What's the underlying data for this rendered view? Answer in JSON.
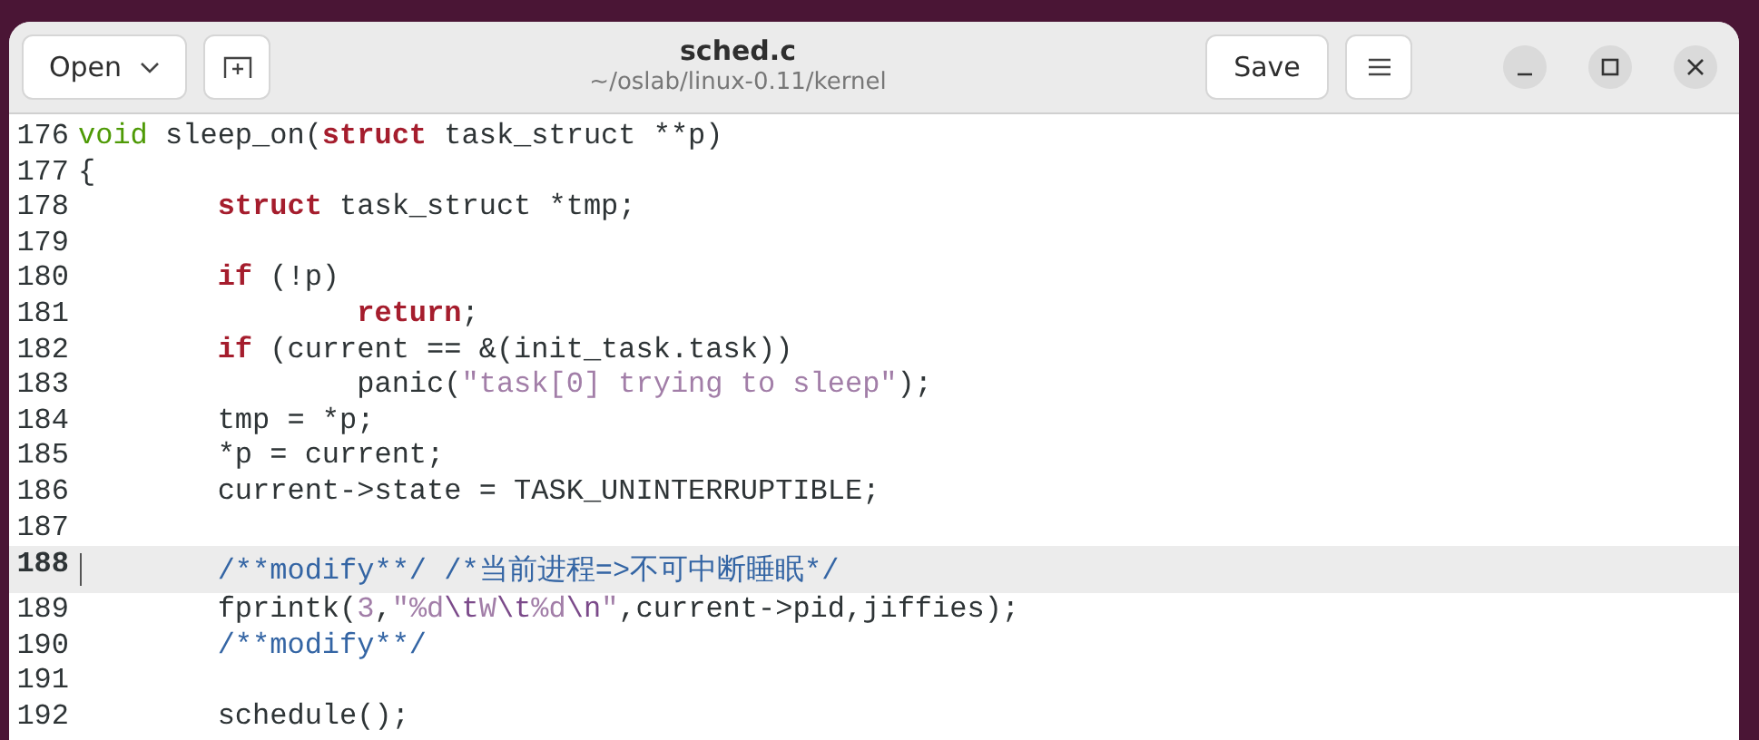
{
  "header": {
    "open_button": "Open",
    "title": "sched.c",
    "subtitle": "~/oslab/linux-0.11/kernel",
    "save_button": "Save"
  },
  "lines": [
    {
      "number": "176",
      "current": false,
      "tokens": [
        {
          "kind": "type",
          "text": "void"
        },
        {
          "kind": "plain",
          "text": " sleep_on("
        },
        {
          "kind": "keyword",
          "text": "struct"
        },
        {
          "kind": "plain",
          "text": " task_struct **p)"
        }
      ]
    },
    {
      "number": "177",
      "current": false,
      "tokens": [
        {
          "kind": "plain",
          "text": "{"
        }
      ]
    },
    {
      "number": "178",
      "current": false,
      "tokens": [
        {
          "kind": "keyword",
          "text": "        struct"
        },
        {
          "kind": "plain",
          "text": " task_struct *tmp;"
        }
      ]
    },
    {
      "number": "179",
      "current": false
    },
    {
      "number": "180",
      "current": false,
      "tokens": [
        {
          "kind": "keyword",
          "text": "        if"
        },
        {
          "kind": "plain",
          "text": " (!p)"
        }
      ]
    },
    {
      "number": "181",
      "current": false,
      "tokens": [
        {
          "kind": "keyword",
          "text": "                return"
        },
        {
          "kind": "plain",
          "text": ";"
        }
      ]
    },
    {
      "number": "182",
      "current": false,
      "tokens": [
        {
          "kind": "keyword",
          "text": "        if"
        },
        {
          "kind": "plain",
          "text": " (current == &(init_task.task))"
        }
      ]
    },
    {
      "number": "183",
      "current": false,
      "tokens": [
        {
          "kind": "plain",
          "text": "                panic("
        },
        {
          "kind": "string",
          "text": "\"task[0] trying to sleep\""
        },
        {
          "kind": "plain",
          "text": ");"
        }
      ]
    },
    {
      "number": "184",
      "current": false,
      "tokens": [
        {
          "kind": "plain",
          "text": "        tmp = *p;"
        }
      ]
    },
    {
      "number": "185",
      "current": false,
      "tokens": [
        {
          "kind": "plain",
          "text": "        *p = current;"
        }
      ]
    },
    {
      "number": "186",
      "current": false,
      "tokens": [
        {
          "kind": "plain",
          "text": "        current->state = TASK_UNINTERRUPTIBLE;"
        }
      ]
    },
    {
      "number": "187",
      "current": false
    },
    {
      "number": "188",
      "current": true,
      "tokens": [
        {
          "kind": "comment",
          "text": "        /**modify**/ /*当前进程=>不可中断睡眠*/"
        }
      ]
    },
    {
      "number": "189",
      "current": false,
      "tokens": [
        {
          "kind": "plain",
          "text": "        fprintk("
        },
        {
          "kind": "number",
          "text": "3"
        },
        {
          "kind": "plain",
          "text": ","
        },
        {
          "kind": "string",
          "text": "\"%d"
        },
        {
          "kind": "escape",
          "text": "\\t"
        },
        {
          "kind": "string",
          "text": "W"
        },
        {
          "kind": "escape",
          "text": "\\t"
        },
        {
          "kind": "string",
          "text": "%d"
        },
        {
          "kind": "escape",
          "text": "\\n"
        },
        {
          "kind": "string",
          "text": "\""
        },
        {
          "kind": "plain",
          "text": ",current->pid,jiffies);"
        }
      ]
    },
    {
      "number": "190",
      "current": false,
      "tokens": [
        {
          "kind": "comment",
          "text": "        /**modify**/"
        }
      ]
    },
    {
      "number": "191",
      "current": false
    },
    {
      "number": "192",
      "current": false,
      "tokens": [
        {
          "kind": "plain",
          "text": "        schedule();"
        }
      ]
    }
  ]
}
